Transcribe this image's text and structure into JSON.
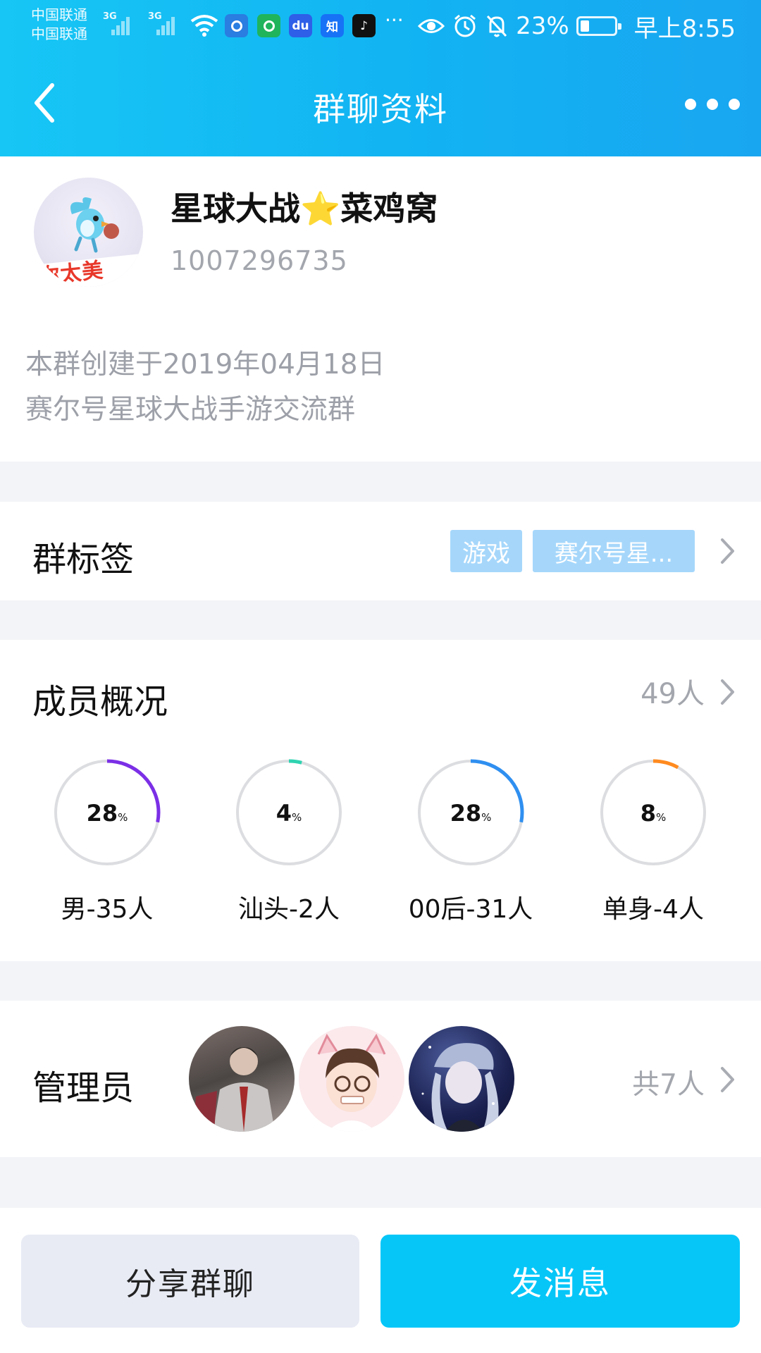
{
  "status_bar": {
    "carrier_1": "中国联通",
    "carrier_2": "中国联通",
    "signal_1_tag": "3G",
    "signal_2_tag": "3G",
    "notification_icons": [
      {
        "icon": "qq-browser-icon",
        "color": "#2a7de1"
      },
      {
        "icon": "tencent-video-icon",
        "color": "#20b45c"
      },
      {
        "icon": "baidu-icon",
        "color": "#2e5fe8",
        "text": "du"
      },
      {
        "icon": "zhihu-icon",
        "color": "#1772f6",
        "text": "知"
      },
      {
        "icon": "douyin-icon",
        "color": "#111111",
        "text": "♪"
      }
    ],
    "overflow": "···",
    "battery_percent": "23%",
    "battery_level": 0.23,
    "time": "早上8:55"
  },
  "nav": {
    "title": "群聊资料"
  },
  "group": {
    "avatar_text": "你太美",
    "name": "星球大战⭐菜鸡窝",
    "id": "1007296735",
    "created": "本群创建于2019年04月18日",
    "description": "赛尔号星球大战手游交流群"
  },
  "tags": {
    "title": "群标签",
    "items": [
      "游戏",
      "赛尔号星..."
    ]
  },
  "members": {
    "title": "成员概况",
    "count": "49人",
    "stats": [
      {
        "value": 28,
        "unit": "%",
        "label": "男-35人",
        "color": "#7b2fe6"
      },
      {
        "value": 4,
        "unit": "%",
        "label": "汕头-2人",
        "color": "#2fd3b0"
      },
      {
        "value": 28,
        "unit": "%",
        "label": "00后-31人",
        "color": "#2f8ff0"
      },
      {
        "value": 8,
        "unit": "%",
        "label": "单身-4人",
        "color": "#ff8a1f"
      }
    ]
  },
  "admins": {
    "title": "管理员",
    "total": "共7人"
  },
  "actions": {
    "share": "分享群聊",
    "send": "发消息"
  },
  "colors": {
    "header_start": "#17c6f5",
    "header_end": "#19a6f1",
    "primary_button": "#06c6f8",
    "tag_chip": "#a6d7fb"
  }
}
